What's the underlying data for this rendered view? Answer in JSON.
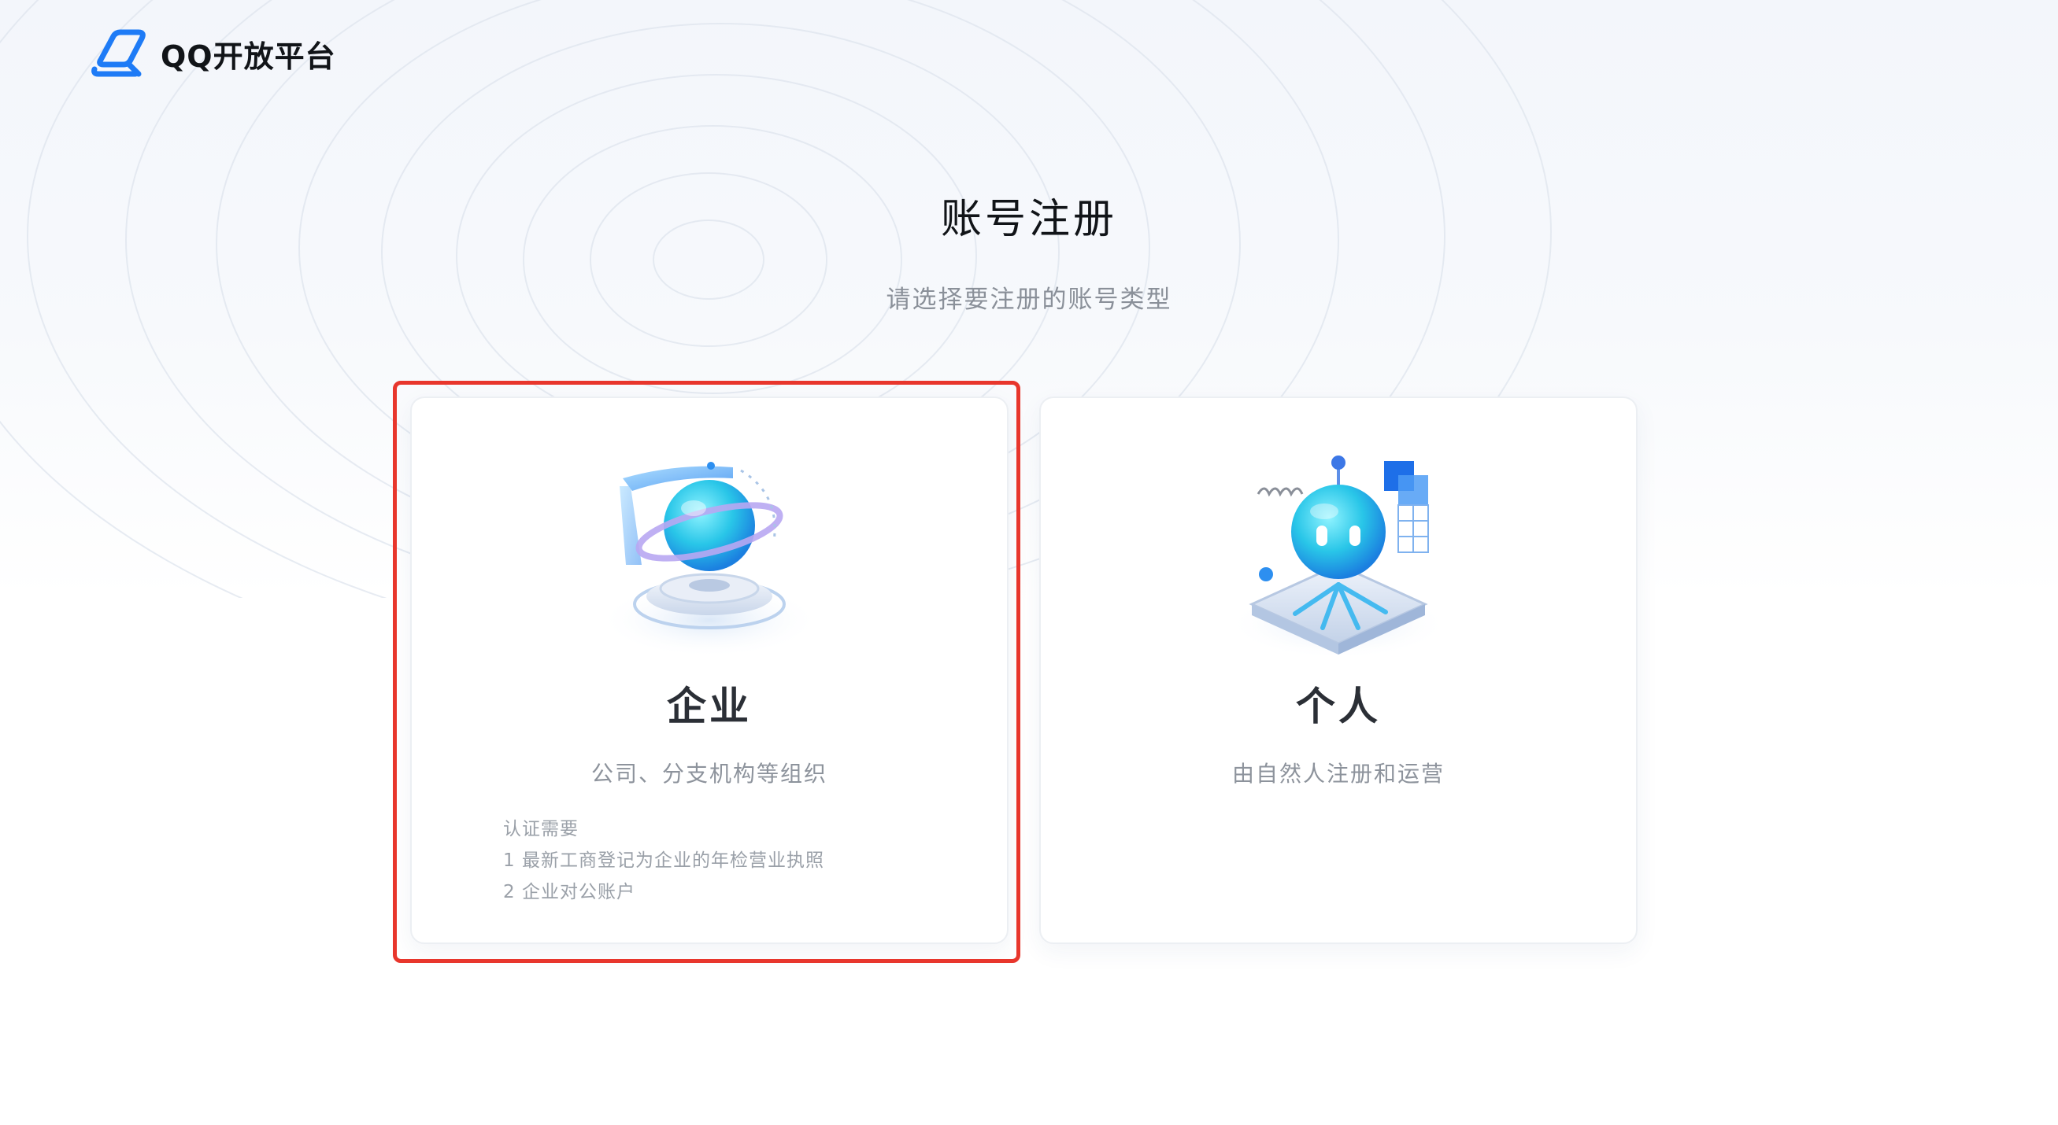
{
  "brand": {
    "logo_text": "QQ开放平台",
    "accent_color": "#1e7bf6"
  },
  "page": {
    "title": "账号注册",
    "subtitle": "请选择要注册的账号类型"
  },
  "cards": {
    "enterprise": {
      "title": "企业",
      "description": "公司、分支机构等组织",
      "requirements_heading": "认证需要",
      "requirements": [
        "1 最新工商登记为企业的年检营业执照",
        "2 企业对公账户"
      ],
      "illustration": "planet-icon",
      "selected": true
    },
    "personal": {
      "title": "个人",
      "description": "由自然人注册和运营",
      "illustration": "robot-icon",
      "selected": false
    }
  },
  "colors": {
    "selection_outline": "#e8362c",
    "title_text": "#111418",
    "muted_text": "#8a9099"
  }
}
